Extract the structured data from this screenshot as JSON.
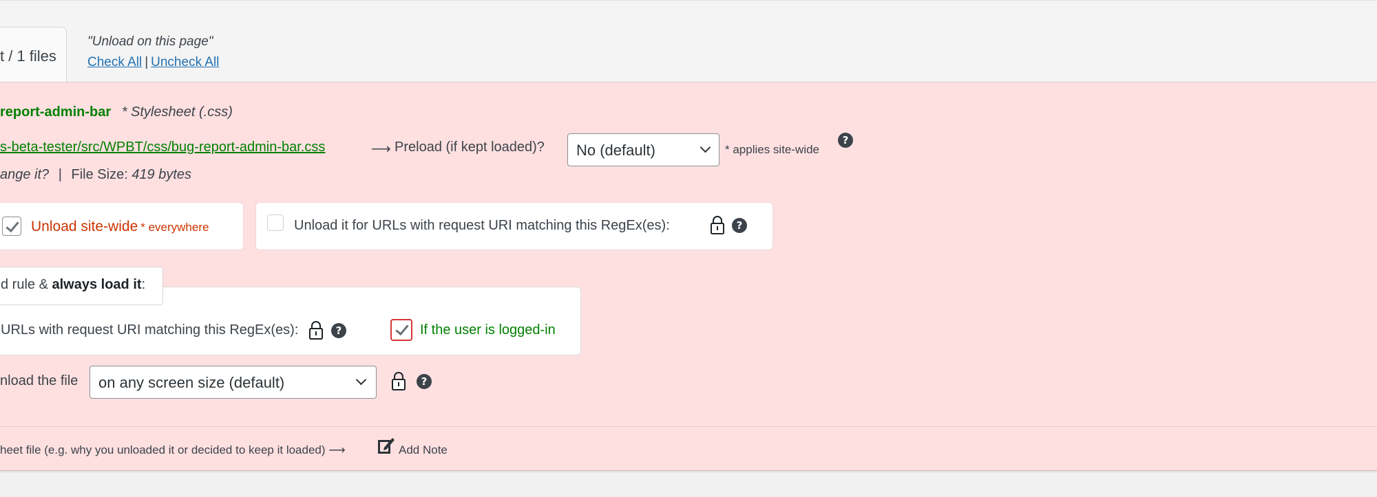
{
  "tab": {
    "label": "t / 1 files"
  },
  "header": {
    "unload_hint": "\"Unload on this page\"",
    "check_all": "Check All",
    "separator": "|",
    "uncheck_all": "Uncheck All"
  },
  "asset": {
    "handle": "report-admin-bar",
    "type": "* Stylesheet (.css)",
    "src": "s-beta-tester/src/WPBT/css/bug-report-admin-bar.css",
    "arrow": "⟶",
    "preload_label": "Preload (if kept loaded)?",
    "preload_value": "No (default)",
    "preload_note": "* applies site-wide",
    "change_prefix": "ange it?",
    "size_sep": "|",
    "size_label": "File Size:",
    "size_value": "419 bytes"
  },
  "unload": {
    "sitewide_label": "Unload site-wide",
    "sitewide_suffix": "* everywhere",
    "sitewide_checked": true,
    "regex_label": "Unload it for URLs with request URI matching this RegEx(es):",
    "regex_checked": false
  },
  "exceptions": {
    "title_prefix": "d rule &",
    "title_bold": "always load it",
    "title_suffix": ":",
    "regex_label": "URLs with request URI matching this RegEx(es):",
    "loggedin_label": "If the user is logged-in",
    "loggedin_checked": true
  },
  "screen": {
    "label": "nload the file",
    "value": "on any screen size (default)"
  },
  "note": {
    "text": "heet file (e.g. why you unloaded it or decided to keep it loaded) ⟶",
    "add_label": "Add Note"
  },
  "icons": {
    "help": "?",
    "lock": "lock-icon",
    "note": "edit-note-icon"
  },
  "colors": {
    "panel_bg": "#ffe0e1",
    "handle": "#008000",
    "unload": "#cc3300",
    "link": "#2271b1",
    "loggedin_border": "#d63638"
  }
}
